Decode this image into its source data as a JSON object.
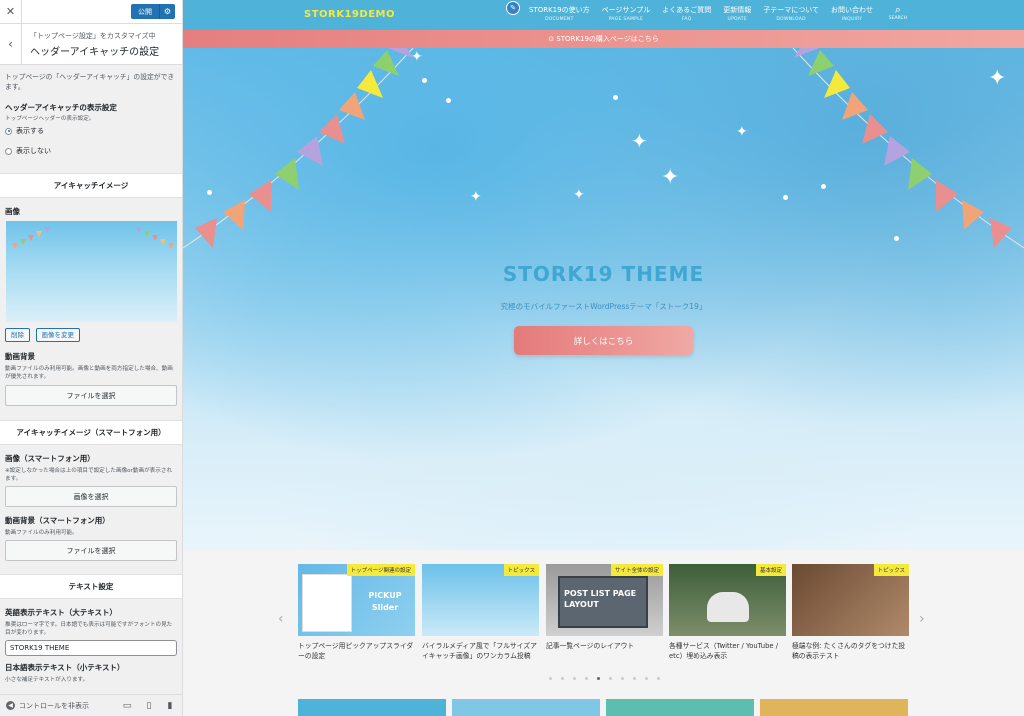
{
  "sidebar": {
    "close": "✕",
    "publish": "公開",
    "gear": "⚙",
    "back": "‹",
    "crumb": "「トップページ設定」をカスタマイズ中",
    "title": "ヘッダーアイキャッチの設定",
    "intro": "トップページの「ヘッダーアイキャッチ」の設定ができます。",
    "display": {
      "label": "ヘッダーアイキャッチの表示設定",
      "desc": "トップページヘッダーの表示設定。",
      "options": [
        "表示する",
        "表示しない"
      ],
      "selected": 0
    },
    "eyecatch": {
      "group": "アイキャッチイメージ",
      "image_label": "画像",
      "remove": "削除",
      "change": "画像を変更",
      "video_label": "動画背景",
      "video_desc": "動画ファイルのみ利用可能。画像と動画を両方指定した場合、動画が優先されます。",
      "select_file": "ファイルを選択"
    },
    "sp": {
      "group": "アイキャッチイメージ（スマートフォン用）",
      "image_label": "画像（スマートフォン用）",
      "image_desc": "※設定しなかった場合は上の項目で設定した画像or動画が表示されます。",
      "select_image": "画像を選択",
      "video_label": "動画背景（スマートフォン用）",
      "video_desc": "動画ファイルのみ利用可能。",
      "select_file": "ファイルを選択"
    },
    "text": {
      "group": "テキスト設定",
      "en_label": "英語表示テキスト（大テキスト）",
      "en_desc": "推奨はローマ字です。日本語でも表示は可能ですがフォントの見た目が変わります。",
      "en_value": "STORK19 THEME",
      "jp_label": "日本語表示テキスト（小テキスト）",
      "jp_desc": "小さな補足テキストが入ります。"
    },
    "footer": {
      "hide": "コントロールを非表示",
      "arrow": "◀",
      "desktop": "▭",
      "tablet": "▯",
      "mobile": "▮"
    }
  },
  "site": {
    "logo": "STORK19DEMO",
    "pencil": "✎",
    "nav": [
      {
        "label": "STORK19の使い方",
        "sub": "DOCUMENT"
      },
      {
        "label": "ページサンプル",
        "sub": "PAGE SAMPLE"
      },
      {
        "label": "よくあるご質問",
        "sub": "FAQ"
      },
      {
        "label": "更新情報",
        "sub": "UPDATE"
      },
      {
        "label": "子テーマについて",
        "sub": "DOWNLOAD"
      },
      {
        "label": "お問い合わせ",
        "sub": "INQUIRY"
      }
    ],
    "search_glyph": "⌕",
    "search": "SEARCH",
    "notice": "⊙ STORK19の購入ページはこちら",
    "hero": {
      "title": "STORK19 THEME",
      "subtitle": "究極のモバイルファーストWordPressテーマ「ストーク19」",
      "button": "詳しくはこちら"
    },
    "pickup": {
      "prev": "‹",
      "next": "›",
      "cards": [
        {
          "tag": "トップページ関連の設定",
          "title": "トップページ用ピックアップスライダーの設定",
          "img_text": "PICKUP Slider"
        },
        {
          "tag": "トピックス",
          "title": "バイラルメディア風で「フルサイズアイキャッチ画像」のワンカラム投稿",
          "img_text": ""
        },
        {
          "tag": "サイト全体の設定",
          "title": "記事一覧ページのレイアウト",
          "img_text": "POST LIST PAGE LAYOUT"
        },
        {
          "tag": "基本設定",
          "title": "各種サービス（Twitter / YouTube / etc）埋め込み表示",
          "img_text": ""
        },
        {
          "tag": "トピックス",
          "title": "極端な例: たくさんのタグをつけた投稿の表示テスト",
          "img_text": ""
        }
      ],
      "active_dot": 4,
      "dot_count": 10
    }
  },
  "colors": {
    "header": "#4fb3d9",
    "logo": "#f5e93b",
    "accent": "#e47a7a",
    "wp_blue": "#2271b1"
  }
}
